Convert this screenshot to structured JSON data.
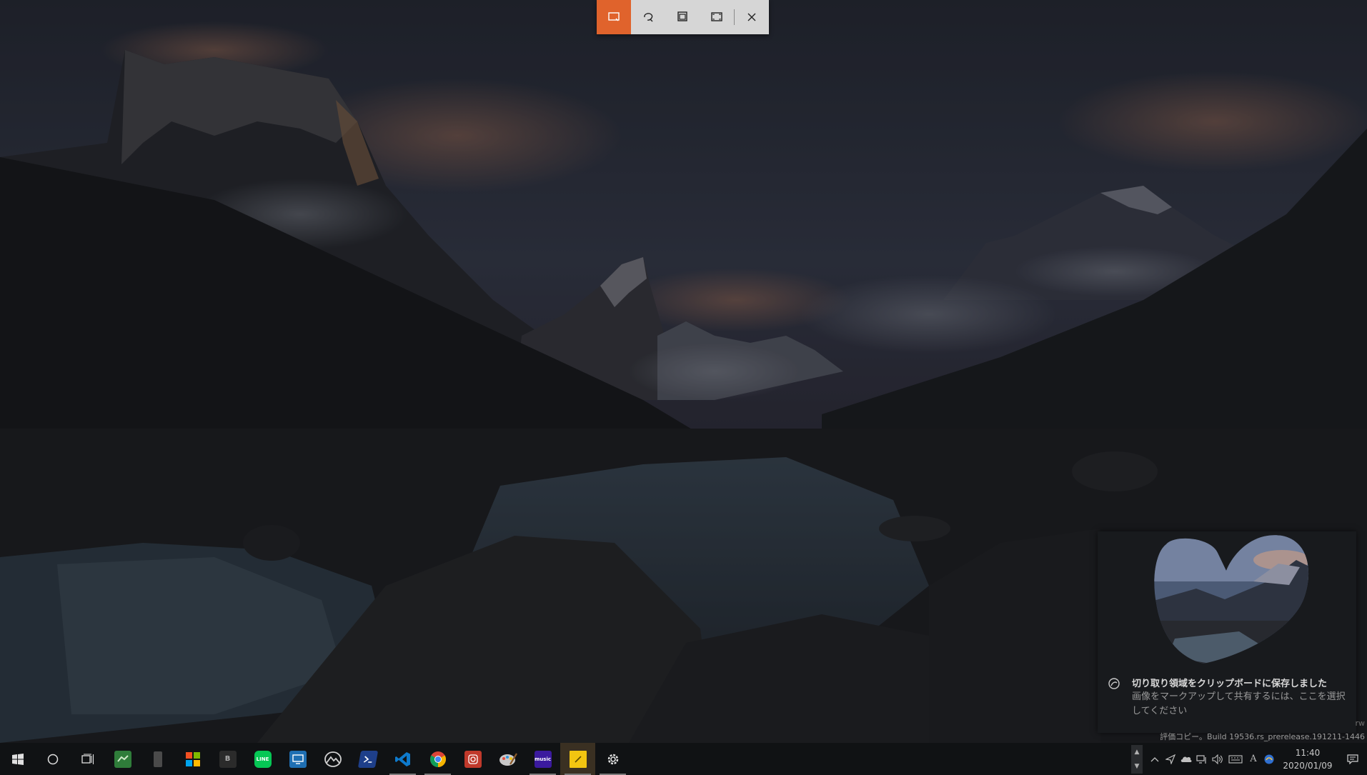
{
  "snip_toolbar": {
    "buttons": [
      {
        "name": "rectangular-snip-icon",
        "active": true
      },
      {
        "name": "freeform-snip-icon",
        "active": false
      },
      {
        "name": "window-snip-icon",
        "active": false
      },
      {
        "name": "fullscreen-snip-icon",
        "active": false
      }
    ],
    "close": {
      "name": "close-icon"
    },
    "accent": "#e0632c"
  },
  "toast": {
    "title": "切り取り領域をクリップボードに保存しました",
    "body": "画像をマークアップして共有するには、ここを選択してください"
  },
  "watermark": {
    "line1": "rw",
    "line2": "評価コピー。Build 19536.rs_prerelease.191211-1446"
  },
  "taskbar": {
    "apps": [
      {
        "name": "start-icon"
      },
      {
        "name": "search-circle-icon"
      },
      {
        "name": "task-view-icon"
      },
      {
        "name": "app-green-icon",
        "color": "#2f7d3a"
      },
      {
        "name": "app-phone-icon",
        "color": "#4a4a4a"
      },
      {
        "name": "microsoft-store-icon"
      },
      {
        "name": "app-b-icon",
        "label": "B",
        "color": "#2b2b2b"
      },
      {
        "name": "line-icon",
        "label": "LINE",
        "color": "#06c755"
      },
      {
        "name": "remote-desktop-icon",
        "color": "#1f6fb2"
      },
      {
        "name": "photos-icon"
      },
      {
        "name": "powershell-icon",
        "color": "#1e3f8a"
      },
      {
        "name": "vscode-icon",
        "color": "#0e7acc",
        "open": true
      },
      {
        "name": "chrome-icon",
        "open": true
      },
      {
        "name": "app-camera-icon",
        "color": "#c0392b"
      },
      {
        "name": "paint-icon"
      },
      {
        "name": "amazon-music-icon",
        "label": "music",
        "color": "#3b1a9e",
        "open": true
      },
      {
        "name": "sticky-notes-icon",
        "color": "#f2c511",
        "open": true,
        "highlight": true
      },
      {
        "name": "settings-icon",
        "open": true
      }
    ],
    "tray": {
      "icons": [
        "chevron-up-icon",
        "location-icon",
        "onedrive-icon",
        "network-icon",
        "volume-icon",
        "keyboard-icon",
        "ime-icon",
        "language-icon"
      ],
      "ime_label": "A",
      "time": "11:40",
      "date": "2020/01/09"
    }
  }
}
